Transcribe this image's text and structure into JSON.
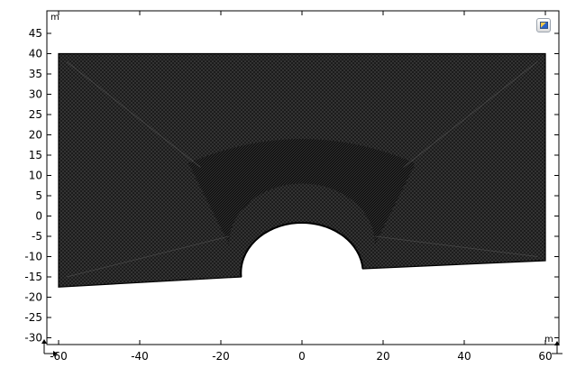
{
  "plot": {
    "y_unit": "m",
    "x_unit": "m",
    "x_ticks": [
      "-60",
      "-40",
      "-20",
      "0",
      "20",
      "40",
      "60"
    ],
    "y_ticks": [
      "45",
      "40",
      "35",
      "30",
      "25",
      "20",
      "15",
      "10",
      "5",
      "0",
      "-5",
      "-10",
      "-15",
      "-20",
      "-25",
      "-30"
    ]
  },
  "geometry": {
    "outline_m": [
      [
        -60,
        40
      ],
      [
        60,
        40
      ],
      [
        60,
        -11
      ],
      [
        15,
        -13
      ],
      [
        -15,
        -15
      ],
      [
        -60,
        -17.5
      ]
    ],
    "arch": {
      "center_x_m": 0,
      "center_y_m": -14.5,
      "radius_m": 13
    },
    "mesh_color": "#1a1a1a",
    "line_color": "#000000"
  },
  "toolbar": {
    "icon": "graphics-toolbar-icon"
  }
}
